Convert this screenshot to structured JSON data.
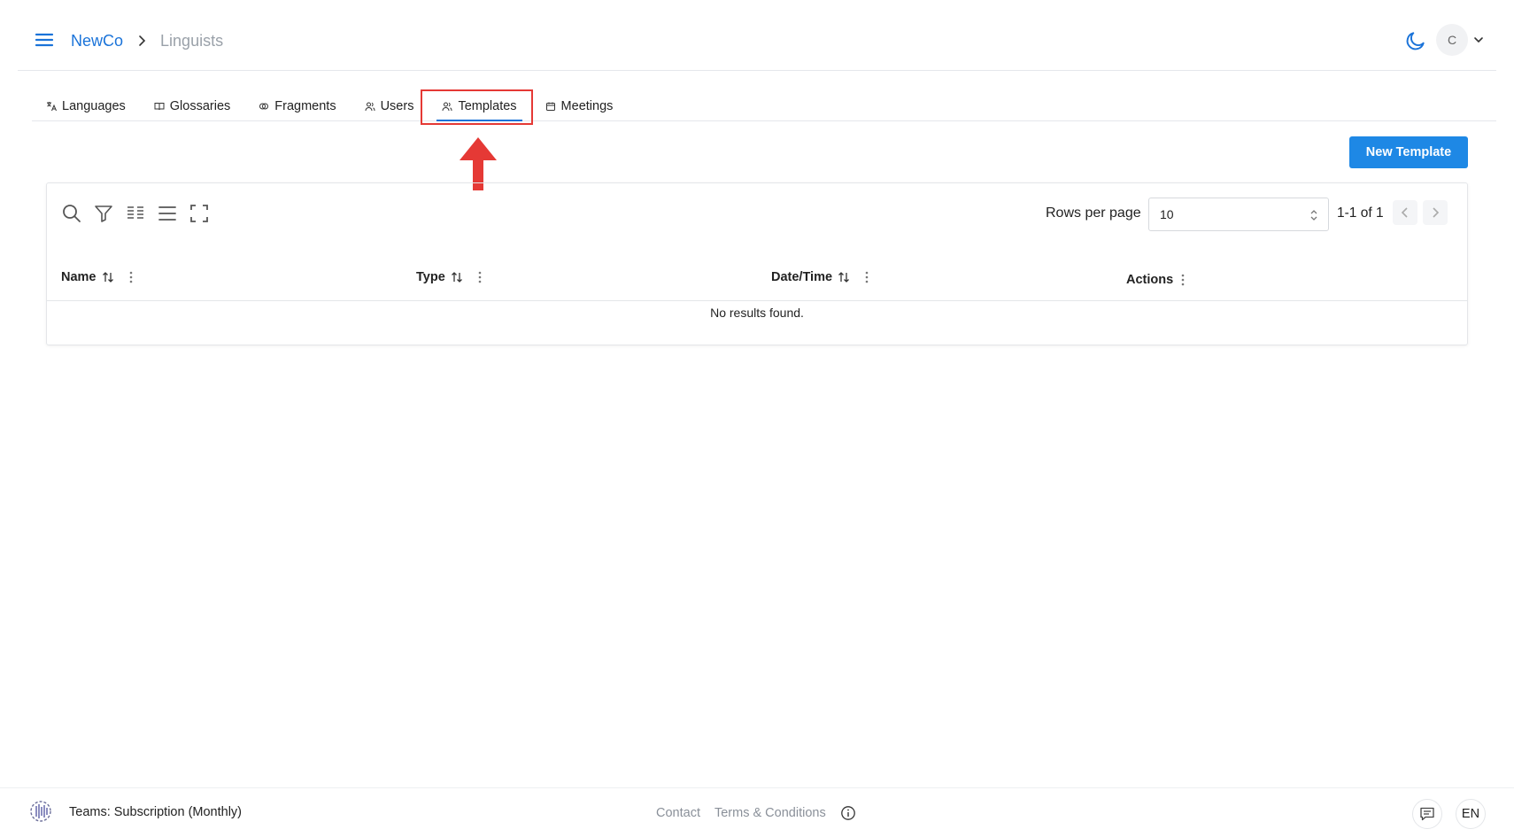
{
  "header": {
    "org": "NewCo",
    "page": "Linguists",
    "avatar_initial": "C"
  },
  "tabs": [
    {
      "label": "Languages",
      "icon": "translate-icon"
    },
    {
      "label": "Glossaries",
      "icon": "book-icon"
    },
    {
      "label": "Fragments",
      "icon": "fragments-icon"
    },
    {
      "label": "Users",
      "icon": "users-icon"
    },
    {
      "label": "Templates",
      "icon": "users-icon",
      "active": true
    },
    {
      "label": "Meetings",
      "icon": "calendar-icon"
    }
  ],
  "new_button_label": "New Template",
  "table": {
    "rows_per_page_label": "Rows per page",
    "rows_per_page_value": "10",
    "page_range": "1-1 of 1",
    "columns": [
      "Name",
      "Type",
      "Date/Time",
      "Actions"
    ],
    "empty_text": "No results found."
  },
  "footer": {
    "plan": "Teams: Subscription (Monthly)",
    "contact": "Contact",
    "terms": "Terms & Conditions",
    "language": "EN"
  },
  "colors": {
    "accent": "#1e88e5",
    "highlight": "#e53935"
  }
}
